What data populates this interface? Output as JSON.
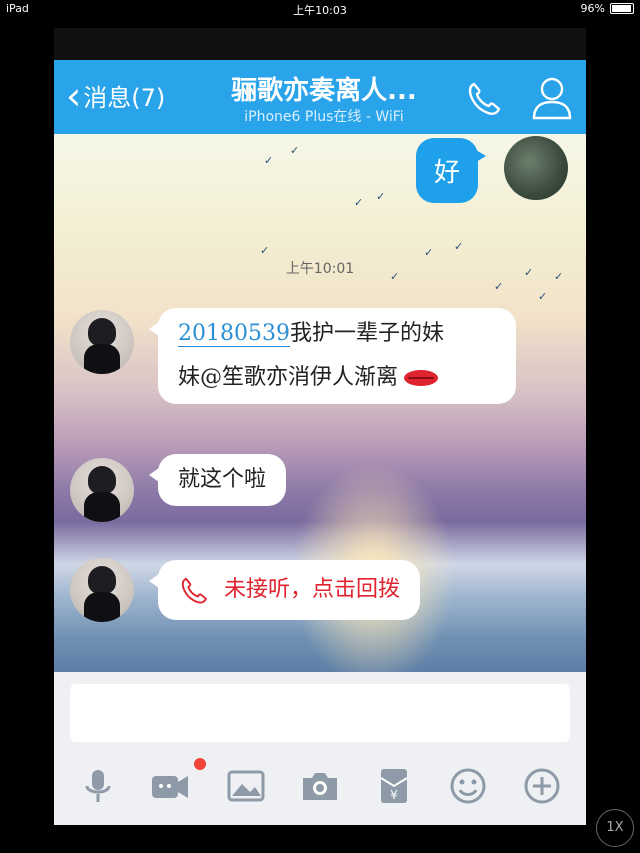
{
  "status": {
    "device": "iPad",
    "time": "上午10:03",
    "battery": "96%"
  },
  "header": {
    "back_label": "消息(7)",
    "title": "骊歌亦奏离人...",
    "subtitle": "iPhone6 Plus在线 - WiFi"
  },
  "chat": {
    "outgoing_text": "好",
    "timestamp": "上午10:01",
    "message1": {
      "mention": "20180539",
      "text_line1": "我护一辈子的妹",
      "text_line2": "妹@笙歌亦消伊人渐离"
    },
    "message2": {
      "text": "就这个啦"
    },
    "message3": {
      "text": "未接听，点击回拨"
    }
  },
  "zoom_label": "1X",
  "colors": {
    "header": "#29a3ea",
    "bubble_out": "#1fa0ea",
    "missed": "#e0242f",
    "badge": "#f0453a"
  },
  "icons": [
    "mic-icon",
    "video-icon",
    "image-icon",
    "camera-icon",
    "red-packet-icon",
    "emoji-icon",
    "plus-icon"
  ]
}
